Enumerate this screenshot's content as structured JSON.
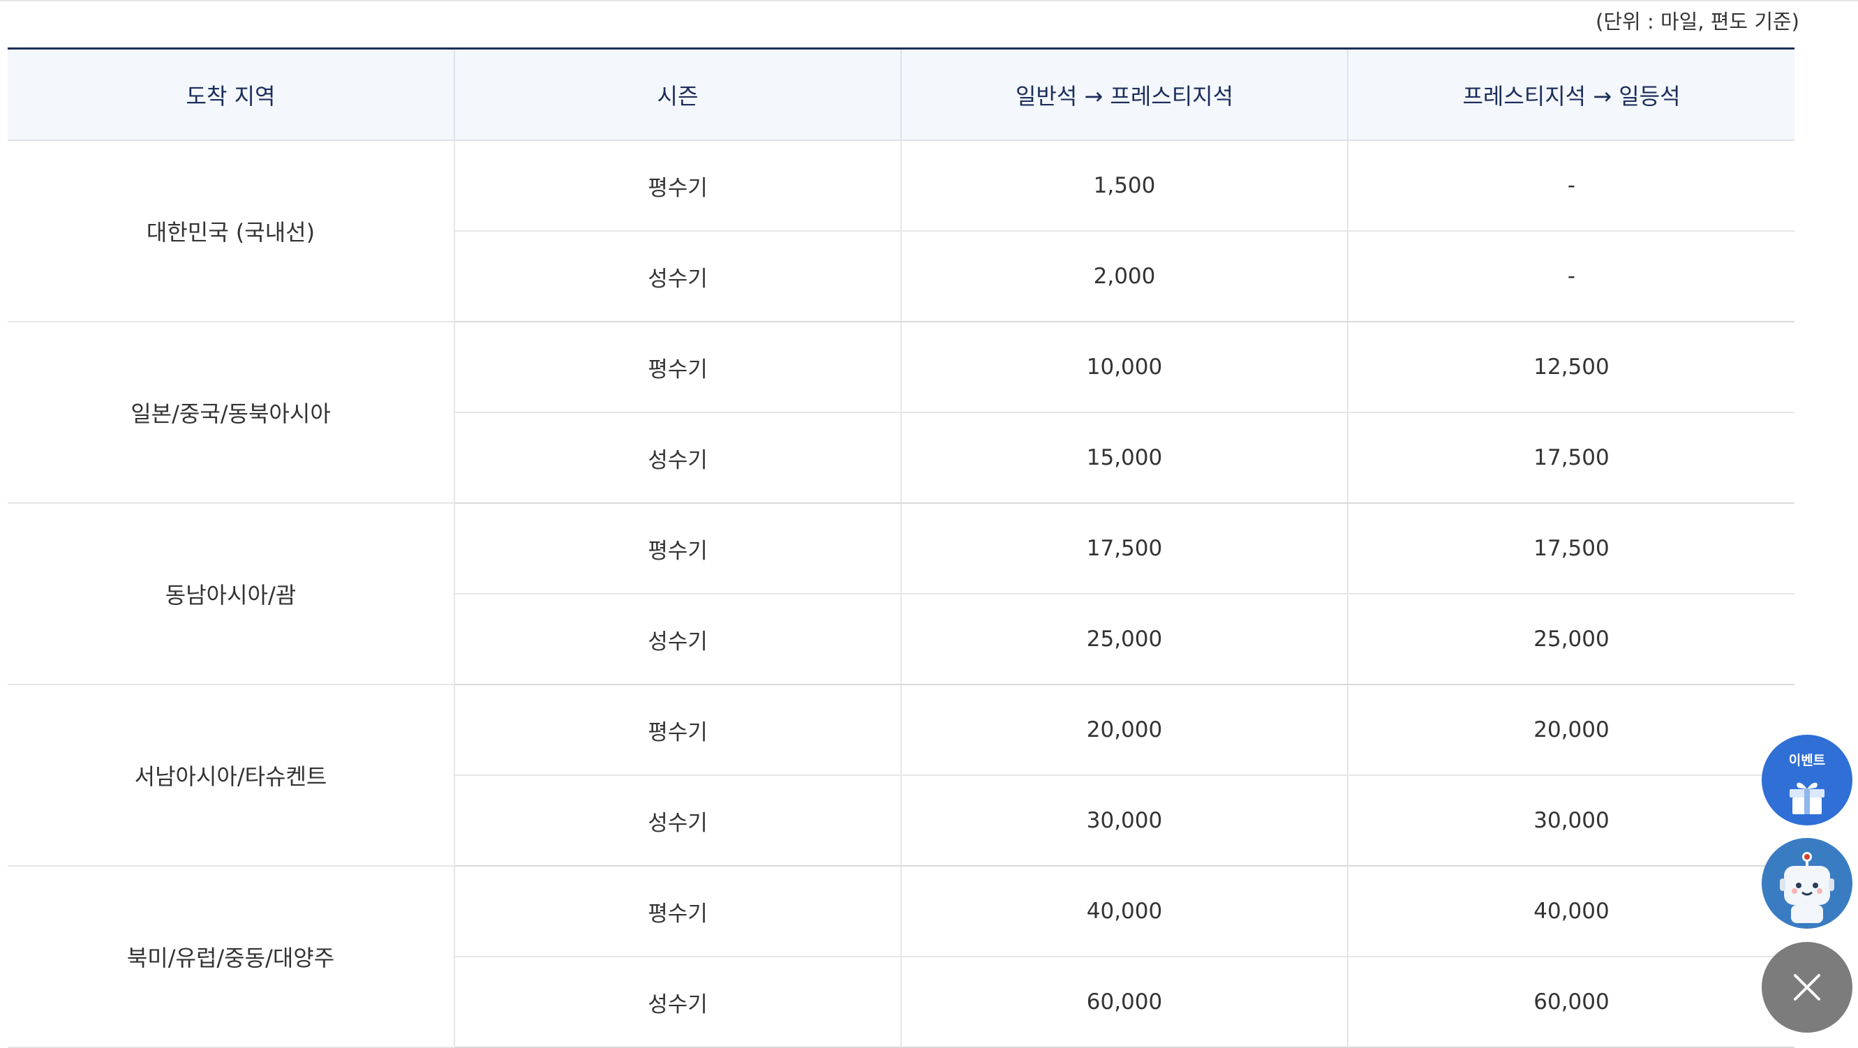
{
  "unit_note": "(단위 : 마일, 편도 기준)",
  "table": {
    "headers": [
      "도착 지역",
      "시즌",
      "일반석 → 프레스티지석",
      "프레스티지석 → 일등석"
    ],
    "rows": [
      {
        "region": "대한민국 (국내선)",
        "season": "평수기",
        "economy_to_prestige": "1,500",
        "prestige_to_first": "-"
      },
      {
        "region": "",
        "season": "성수기",
        "economy_to_prestige": "2,000",
        "prestige_to_first": "-"
      },
      {
        "region": "일본/중국/동북아시아",
        "season": "평수기",
        "economy_to_prestige": "10,000",
        "prestige_to_first": "12,500"
      },
      {
        "region": "",
        "season": "성수기",
        "economy_to_prestige": "15,000",
        "prestige_to_first": "17,500"
      },
      {
        "region": "동남아시아/괌",
        "season": "평수기",
        "economy_to_prestige": "17,500",
        "prestige_to_first": "17,500"
      },
      {
        "region": "",
        "season": "성수기",
        "economy_to_prestige": "25,000",
        "prestige_to_first": "25,000"
      },
      {
        "region": "서남아시아/타슈켄트",
        "season": "평수기",
        "economy_to_prestige": "20,000",
        "prestige_to_first": "20,000"
      },
      {
        "region": "",
        "season": "성수기",
        "economy_to_prestige": "30,000",
        "prestige_to_first": "30,000"
      },
      {
        "region": "북미/유럽/중동/대양주",
        "season": "평수기",
        "economy_to_prestige": "40,000",
        "prestige_to_first": "40,000"
      },
      {
        "region": "",
        "season": "성수기",
        "economy_to_prestige": "60,000",
        "prestige_to_first": "60,000"
      }
    ]
  },
  "floating": {
    "event_label": "이벤트",
    "event_icon": "gift-icon",
    "chatbot_icon": "chatbot-icon",
    "close_icon": "close-icon"
  },
  "colors": {
    "header_bg": "#f4f7fc",
    "header_text": "#1b2d5a",
    "event_button": "#2f6fd6",
    "chatbot_button": "#3a7cc2",
    "close_button": "#7c7c7c"
  }
}
